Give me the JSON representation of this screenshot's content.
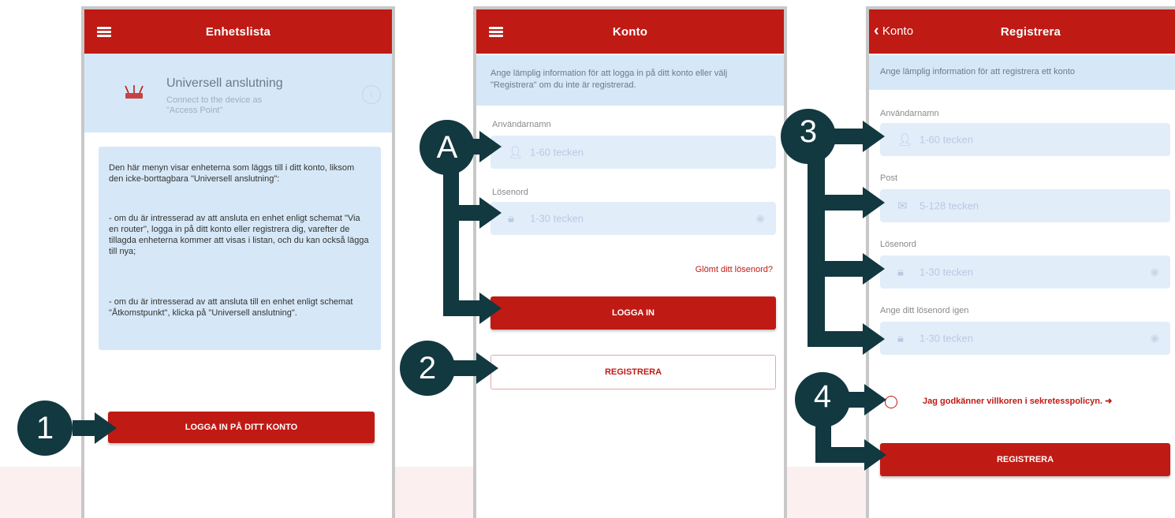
{
  "colors": {
    "brand_red": "#c01a14",
    "info_blue": "#d6e8f7",
    "field_blue": "#e2edfa",
    "callout_dark": "#123840"
  },
  "screen1": {
    "title": "Enhetslista",
    "device": {
      "name": "Universell anslutning",
      "subtitle_line1": "Connect to the device as",
      "subtitle_line2": "\"Access Point\""
    },
    "help_text": [
      "Den här menyn visar enheterna som läggs till i ditt konto, liksom den icke-borttagbara \"Universell anslutning\":",
      "- om du är intresserad av att ansluta en enhet enligt schemat \"Via en router\", logga in på ditt konto eller registrera dig, varefter de tillagda enheterna kommer att visas i listan, och du kan också lägga till nya;",
      "- om du är intresserad av att ansluta till en enhet enligt schemat \"Åtkomstpunkt\", klicka på \"Universell anslutning\"."
    ],
    "login_button": "LOGGA IN PÅ DITT KONTO"
  },
  "screen2": {
    "title": "Konto",
    "info": "Ange lämplig information för att logga in på ditt konto eller välj \"Registrera\" om du inte är registrerad.",
    "username_label": "Användarnamn",
    "username_placeholder": "1-60 tecken",
    "password_label": "Lösenord",
    "password_placeholder": "1-30 tecken",
    "forgot_link": "Glömt ditt lösenord?",
    "login_button": "LOGGA IN",
    "register_button": "REGISTRERA"
  },
  "screen3": {
    "back_label": "Konto",
    "title": "Registrera",
    "info": "Ange lämplig information för att registrera ett konto",
    "username_label": "Användarnamn",
    "username_placeholder": "1-60 tecken",
    "email_label": "Post",
    "email_placeholder": "5-128 tecken",
    "password_label": "Lösenord",
    "password_placeholder": "1-30 tecken",
    "password2_label": "Ange ditt lösenord igen",
    "password2_placeholder": "1-30 tecken",
    "consent_text": "Jag godkänner villkoren i sekretesspolicyn.",
    "register_button": "REGISTRERA"
  },
  "callouts": {
    "c1": "1",
    "c2": "2",
    "c3": "3",
    "c4": "4",
    "cA": "A"
  },
  "icons": [
    "menu-icon",
    "router-icon",
    "info-icon",
    "user-icon",
    "lock-icon",
    "eye-icon",
    "mail-icon",
    "chevron-left-icon",
    "checkbox-icon",
    "arrow-icon"
  ]
}
